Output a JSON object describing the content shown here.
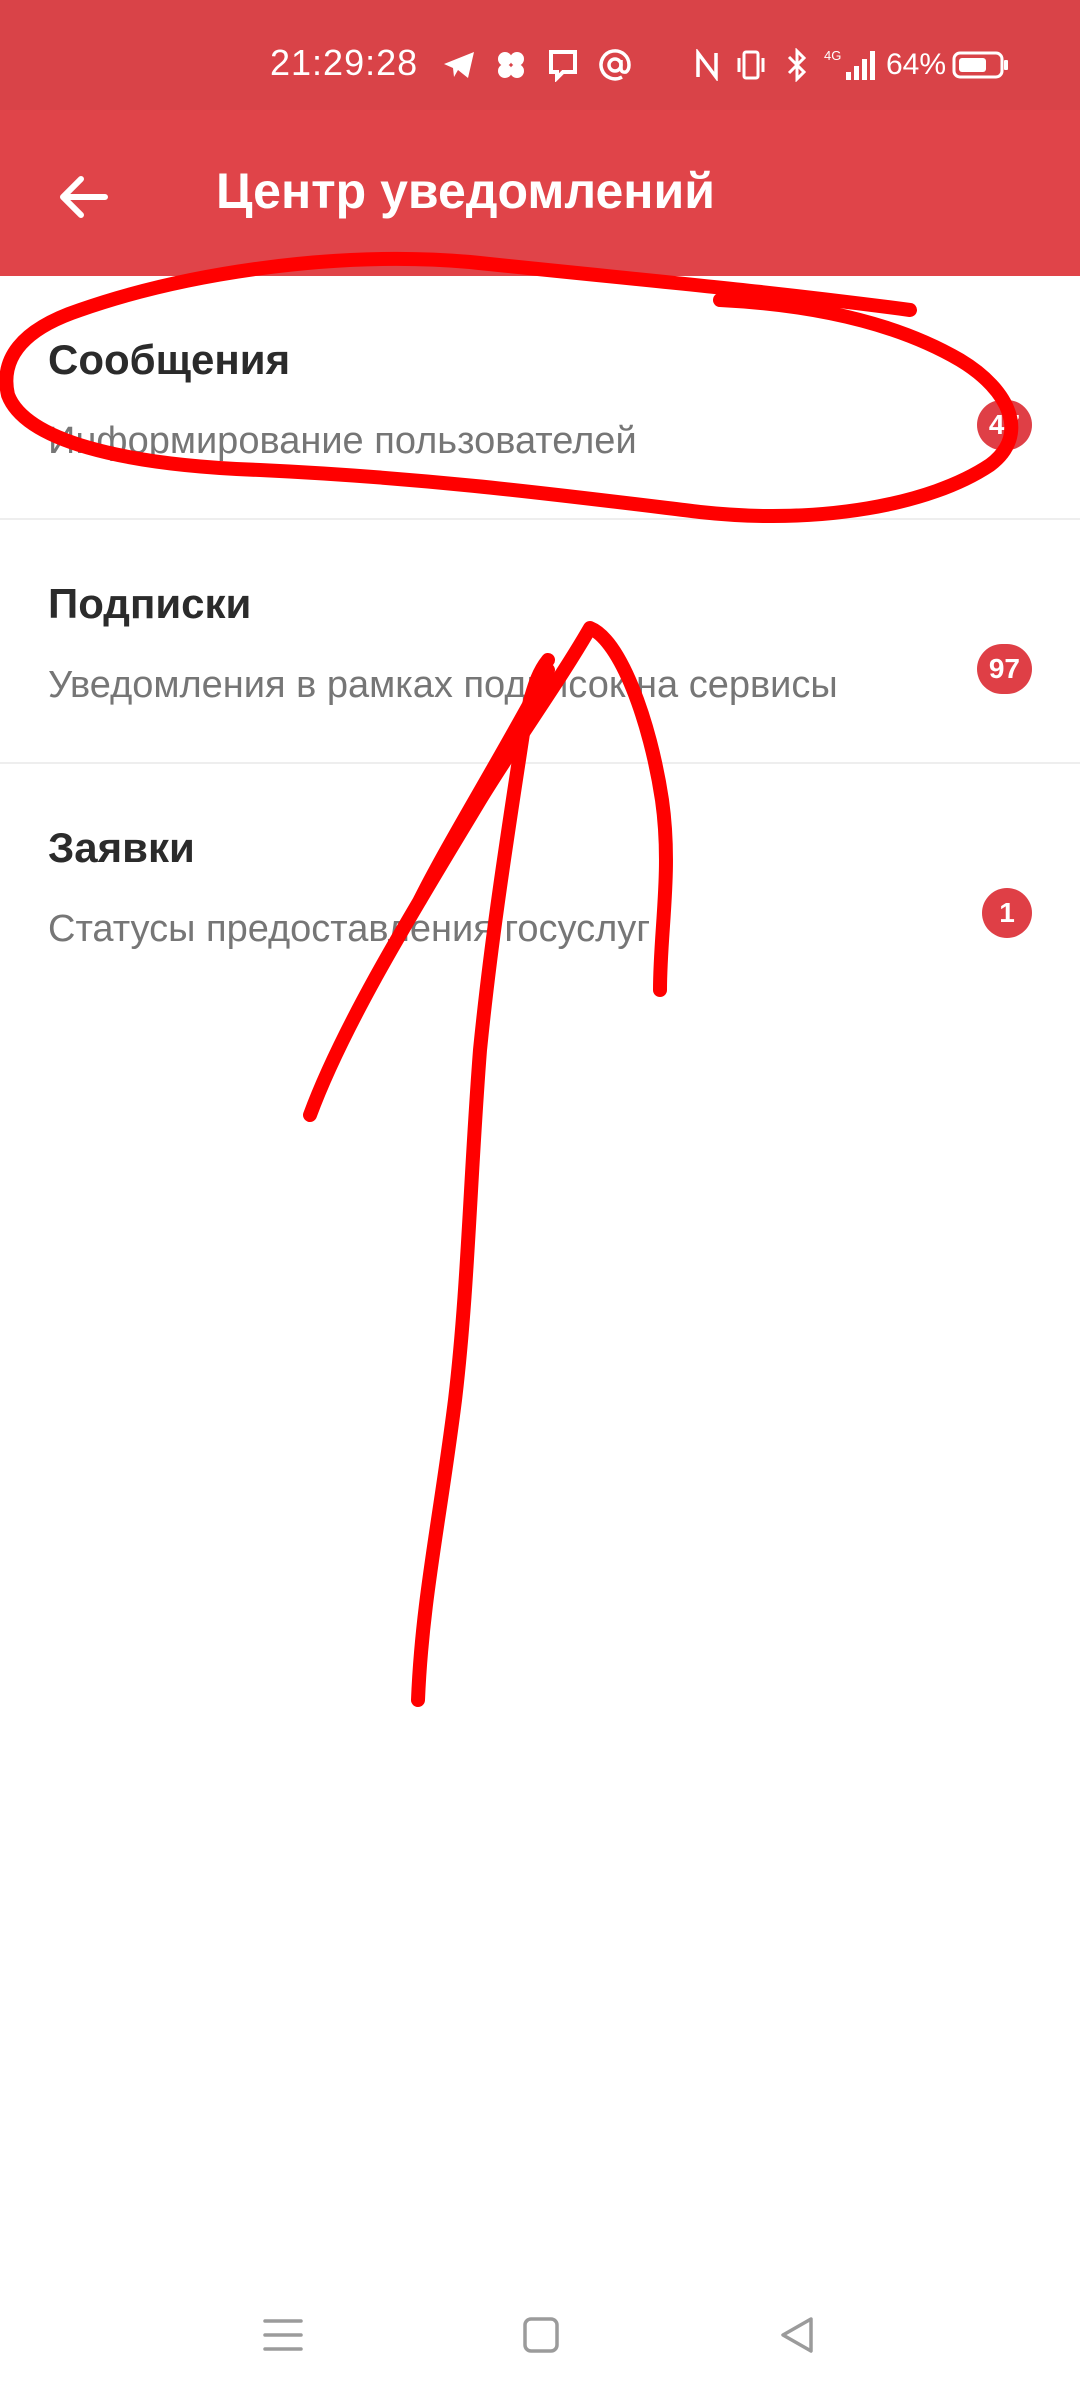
{
  "status_bar": {
    "time": "21:29:28",
    "battery_percent": "64%",
    "network": "4G",
    "icons": [
      "telegram-icon",
      "app-cluster-icon",
      "message-icon",
      "at-icon",
      "nfc-icon",
      "vibrate-icon",
      "bluetooth-icon",
      "signal-icon",
      "battery-icon"
    ]
  },
  "app_bar": {
    "title": "Центр уведомлений",
    "back_icon": "arrow-left-icon"
  },
  "list": {
    "items": [
      {
        "title": "Сообщения",
        "subtitle": "Информирование пользователей",
        "badge": "47"
      },
      {
        "title": "Подписки",
        "subtitle": "Уведомления в рамках подписок на сервисы",
        "badge": "97"
      },
      {
        "title": "Заявки",
        "subtitle": "Статусы предоставления госуслуг",
        "badge": "1"
      }
    ]
  },
  "nav_bar": {
    "icons": [
      "menu-icon",
      "home-icon",
      "back-triangle-icon"
    ]
  },
  "colors": {
    "status_bar": "#d94348",
    "app_bar": "#e04449",
    "badge": "#df3f46",
    "annotation": "#ff0000"
  }
}
